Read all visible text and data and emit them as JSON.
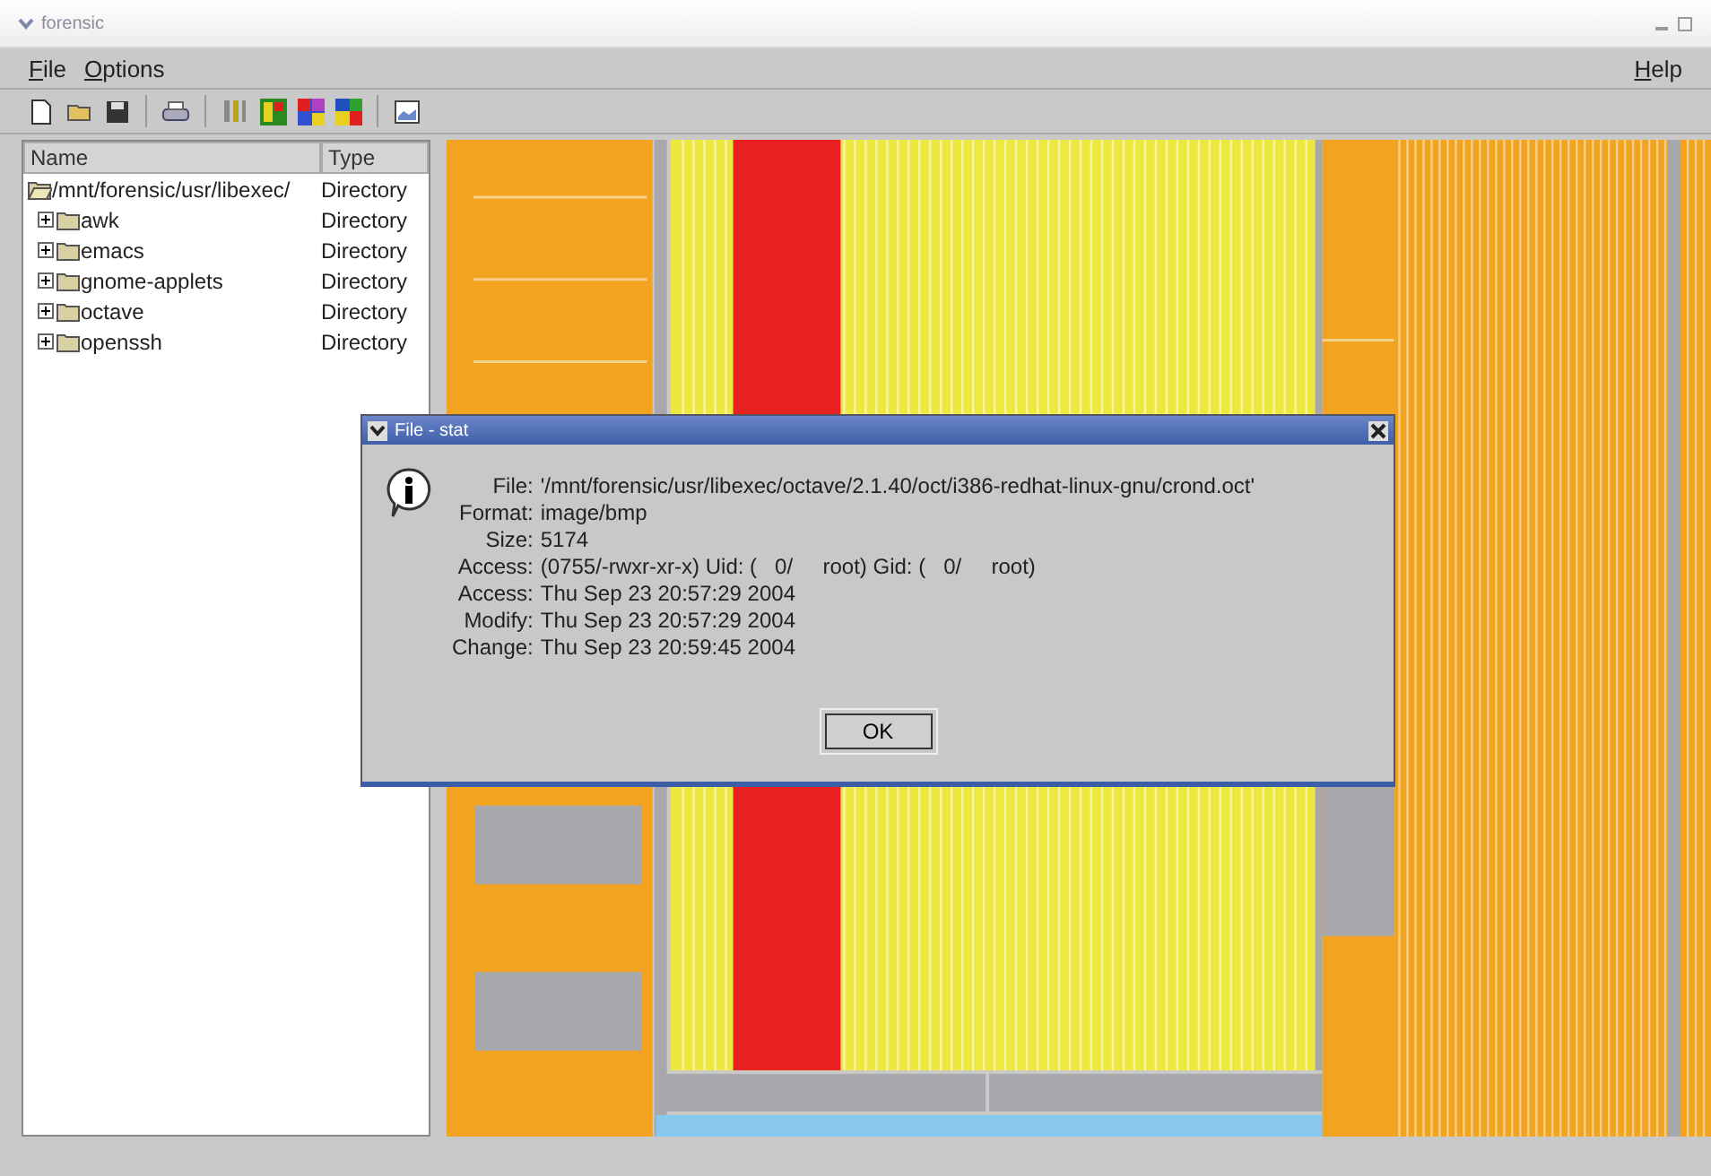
{
  "window": {
    "title": "forensic"
  },
  "menu": [
    {
      "label": "File"
    },
    {
      "label": "Options"
    },
    {
      "label": "Help"
    }
  ],
  "tree": {
    "columns": [
      "Name",
      "Type"
    ],
    "root": {
      "name": "/mnt/forensic/usr/libexec/",
      "type": "Directory",
      "expanded": true,
      "children": [
        {
          "name": "awk",
          "type": "Directory",
          "expanded": false
        },
        {
          "name": "emacs",
          "type": "Directory",
          "expanded": false
        },
        {
          "name": "gnome-applets",
          "type": "Directory",
          "expanded": false
        },
        {
          "name": "octave",
          "type": "Directory",
          "expanded": false
        },
        {
          "name": "openssh",
          "type": "Directory",
          "expanded": false
        }
      ]
    }
  },
  "dialog": {
    "title": "File - stat",
    "lines": [
      {
        "label": "File:",
        "value": "'/mnt/forensic/usr/libexec/octave/2.1.40/oct/i386-redhat-linux-gnu/crond.oct'"
      },
      {
        "label": "Format:",
        "value": "image/bmp"
      },
      {
        "label": "Size:",
        "value": "5174"
      },
      {
        "label": "Access:",
        "value": "(0755/-rwxr-xr-x) Uid: (   0/     root) Gid: (   0/     root)"
      },
      {
        "label": "Access:",
        "value": "Thu Sep 23 20:57:29 2004"
      },
      {
        "label": "Modify:",
        "value": "Thu Sep 23 20:57:29 2004"
      },
      {
        "label": "Change:",
        "value": "Thu Sep 23 20:59:45 2004"
      }
    ],
    "button": "OK"
  }
}
